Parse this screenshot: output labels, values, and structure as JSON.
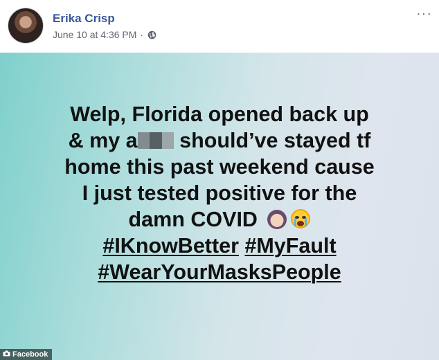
{
  "post": {
    "author": "Erika Crisp",
    "timestamp": "June 10 at 4:36 PM",
    "separator": "·",
    "privacy_icon": "globe-icon",
    "more_label": "···",
    "text_lines": [
      "Welp, Florida opened back up",
      "home this past weekend cause",
      "I just tested positive for the"
    ],
    "line2_before": "& my a",
    "line2_after": " should’ve stayed tf",
    "line5": "damn COVID",
    "emojis": [
      "facepalm-emoji",
      "loudly-crying-face-emoji"
    ],
    "hashtags": [
      "#IKnowBetter",
      "#MyFault",
      "#WearYourMasksPeople"
    ],
    "background_colors": [
      "#7fd0cc",
      "#dce2ec"
    ]
  },
  "source_badge": {
    "icon": "camera-icon",
    "label": "Facebook"
  }
}
